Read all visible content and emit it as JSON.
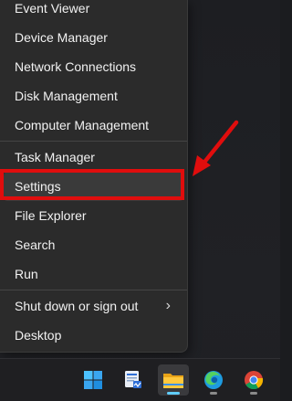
{
  "context_menu": {
    "items": [
      {
        "label": "Event Viewer"
      },
      {
        "label": "Device Manager"
      },
      {
        "label": "Network Connections"
      },
      {
        "label": "Disk Management"
      },
      {
        "label": "Computer Management"
      },
      {
        "label": "Task Manager"
      },
      {
        "label": "Settings"
      },
      {
        "label": "File Explorer"
      },
      {
        "label": "Search"
      },
      {
        "label": "Run"
      },
      {
        "label": "Shut down or sign out",
        "submenu_icon": "›"
      },
      {
        "label": "Desktop"
      }
    ],
    "selected_item": "Settings"
  },
  "annotation": {
    "color": "#e00d0d"
  },
  "taskbar": {
    "icons": [
      "windows-start-icon",
      "task-manager-icon",
      "file-explorer-icon",
      "edge-browser-icon",
      "chrome-browser-icon"
    ],
    "active": "file-explorer-icon"
  },
  "colors": {
    "menu_bg": "#2b2b2b",
    "selected_bg": "#3a3a3a",
    "text": "#f2f2f2",
    "accent": "#60cdff"
  }
}
